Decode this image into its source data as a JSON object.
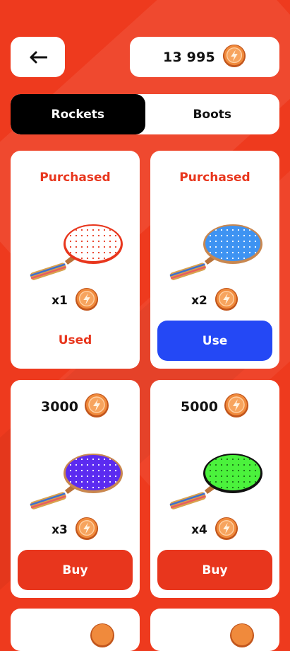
{
  "header": {
    "back_icon": "arrow-left-icon",
    "balance": "13 995",
    "coin_icon": "coin-icon"
  },
  "tabs": [
    {
      "label": "Rockets",
      "active": true
    },
    {
      "label": "Boots",
      "active": false
    }
  ],
  "items": [
    {
      "status": "Purchased",
      "color": "#FFFFFF",
      "dot_color": "#E8361D",
      "rim_color": "#E8361D",
      "multiplier": "x1",
      "action": "Used"
    },
    {
      "status": "Purchased",
      "color": "#3E93F2",
      "dot_color": "#FFFFFF",
      "rim_color": "#C9874F",
      "multiplier": "x2",
      "action": "Use"
    },
    {
      "price": "3000",
      "color": "#5B2BF0",
      "dot_color": "#FFFFFF",
      "rim_color": "#C9874F",
      "multiplier": "x3",
      "action": "Buy"
    },
    {
      "price": "5000",
      "color": "#4BF23C",
      "dot_color": "#1A6E16",
      "rim_color": "#111111",
      "multiplier": "x4",
      "action": "Buy"
    }
  ],
  "colors": {
    "background": "#EE3A1E",
    "accent_red": "#E8361D",
    "accent_blue": "#2448F5"
  }
}
